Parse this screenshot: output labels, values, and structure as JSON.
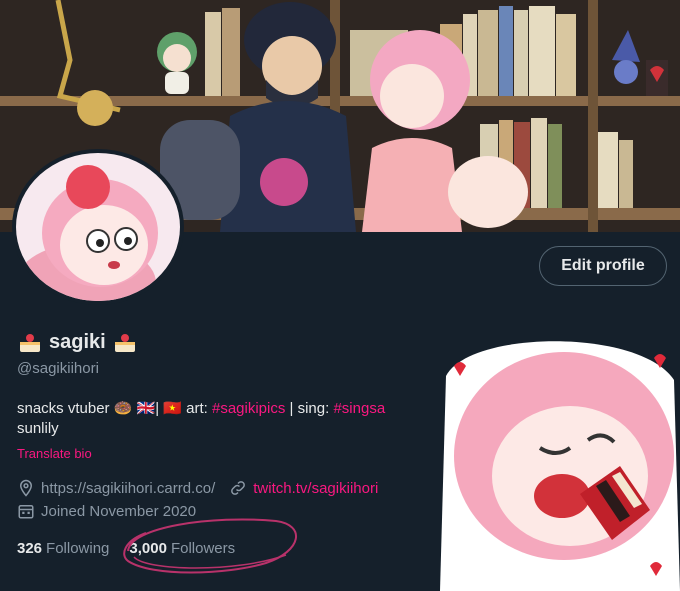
{
  "profile": {
    "display_name": "sagiki",
    "handle": "@sagikiihori",
    "edit_button": "Edit profile",
    "bio": {
      "prefix": "snacks vtuber 🍩 🇬🇧| 🇻🇳 art: ",
      "tag_art": "#sagikipics",
      "separator": " | sing: ",
      "tag_sing": "#singsa",
      "line2": "sunlily"
    },
    "translate_label": "Translate bio",
    "website": "https://sagikiihori.carrd.co/",
    "other_link": "twitch.tv/sagikiihori",
    "joined": "Joined November 2020",
    "following_count": "326",
    "following_label": "Following",
    "followers_count": "3,000",
    "followers_label": "Followers"
  },
  "icons": {
    "name_emoji": "cake-icon",
    "location": "location-pin-icon",
    "link": "link-icon",
    "calendar": "calendar-icon"
  },
  "colors": {
    "background": "#15202b",
    "accent": "#f91880",
    "secondary_text": "#8b98a5",
    "primary_text": "#e7e9ea"
  }
}
